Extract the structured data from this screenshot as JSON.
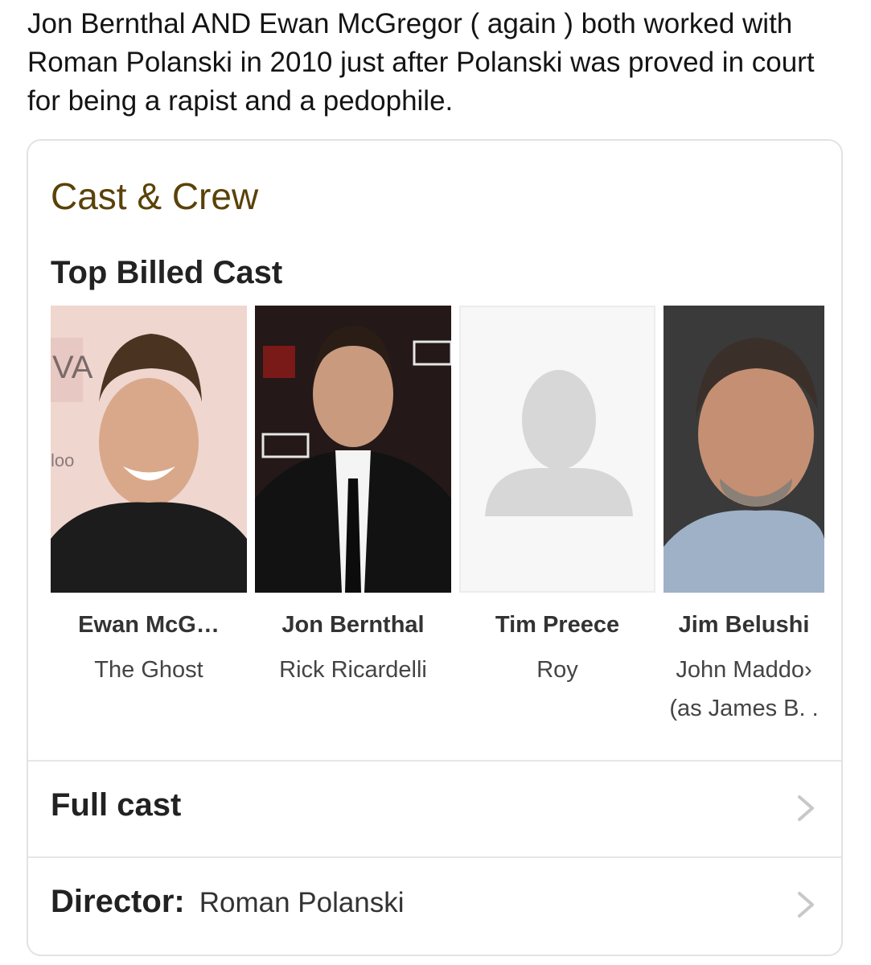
{
  "tweet": {
    "text": "Jon Bernthal AND Ewan McGregor ( again ) both worked with Roman Polanski in 2010 just after Polanski was proved in court for being a rapist and a pedophile."
  },
  "card": {
    "title": "Cast & Crew",
    "section_title": "Top Billed Cast",
    "cast": [
      {
        "name": "Ewan McG…",
        "role": "The Ghost",
        "role2": "",
        "photo": "portrait-smiling-man"
      },
      {
        "name": "Jon Bernthal",
        "role": "Rick Ricardelli",
        "role2": "",
        "photo": "portrait-man-in-suit"
      },
      {
        "name": "Tim Preece",
        "role": "Roy",
        "role2": "",
        "photo": "placeholder-person-icon"
      },
      {
        "name": "Jim Belushi",
        "role": "John Maddo›",
        "role2": "(as James B. .",
        "photo": "portrait-bearded-man"
      }
    ],
    "full_cast_label": "Full cast",
    "director_label": "Director:",
    "director_name": "Roman Polanski"
  },
  "colors": {
    "title_brown": "#5a4208",
    "divider": "#e6e6e6",
    "chevron": "#c8c8c8"
  }
}
